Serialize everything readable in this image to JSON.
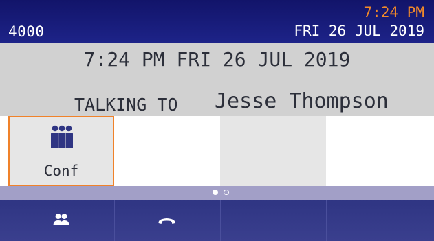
{
  "status_bar": {
    "extension": "4000",
    "time": "7:24 PM",
    "date": "FRI 26 JUL 2019"
  },
  "call_info": {
    "datetime": "7:24 PM FRI 26 JUL 2019",
    "talking_label": "TALKING TO",
    "caller_name": "Jesse Thompson"
  },
  "softkeys": [
    {
      "label": "Conf",
      "icon": "conference-icon",
      "selected": true
    },
    {
      "label": ""
    },
    {
      "label": ""
    },
    {
      "label": ""
    }
  ],
  "pagination": {
    "current_page": 1,
    "total_pages": 2
  },
  "nav_buttons": [
    {
      "icon": "contacts-icon"
    },
    {
      "icon": "hang-up-icon"
    },
    {
      "icon": ""
    },
    {
      "icon": ""
    }
  ],
  "colors": {
    "status_bar": "#1a1f7e",
    "time_accent": "#f28a2a",
    "info_panel": "#d1d1d1",
    "selection_border": "#f0822a",
    "page_bar": "#a29fc7",
    "nav_bar": "#363b8a"
  }
}
